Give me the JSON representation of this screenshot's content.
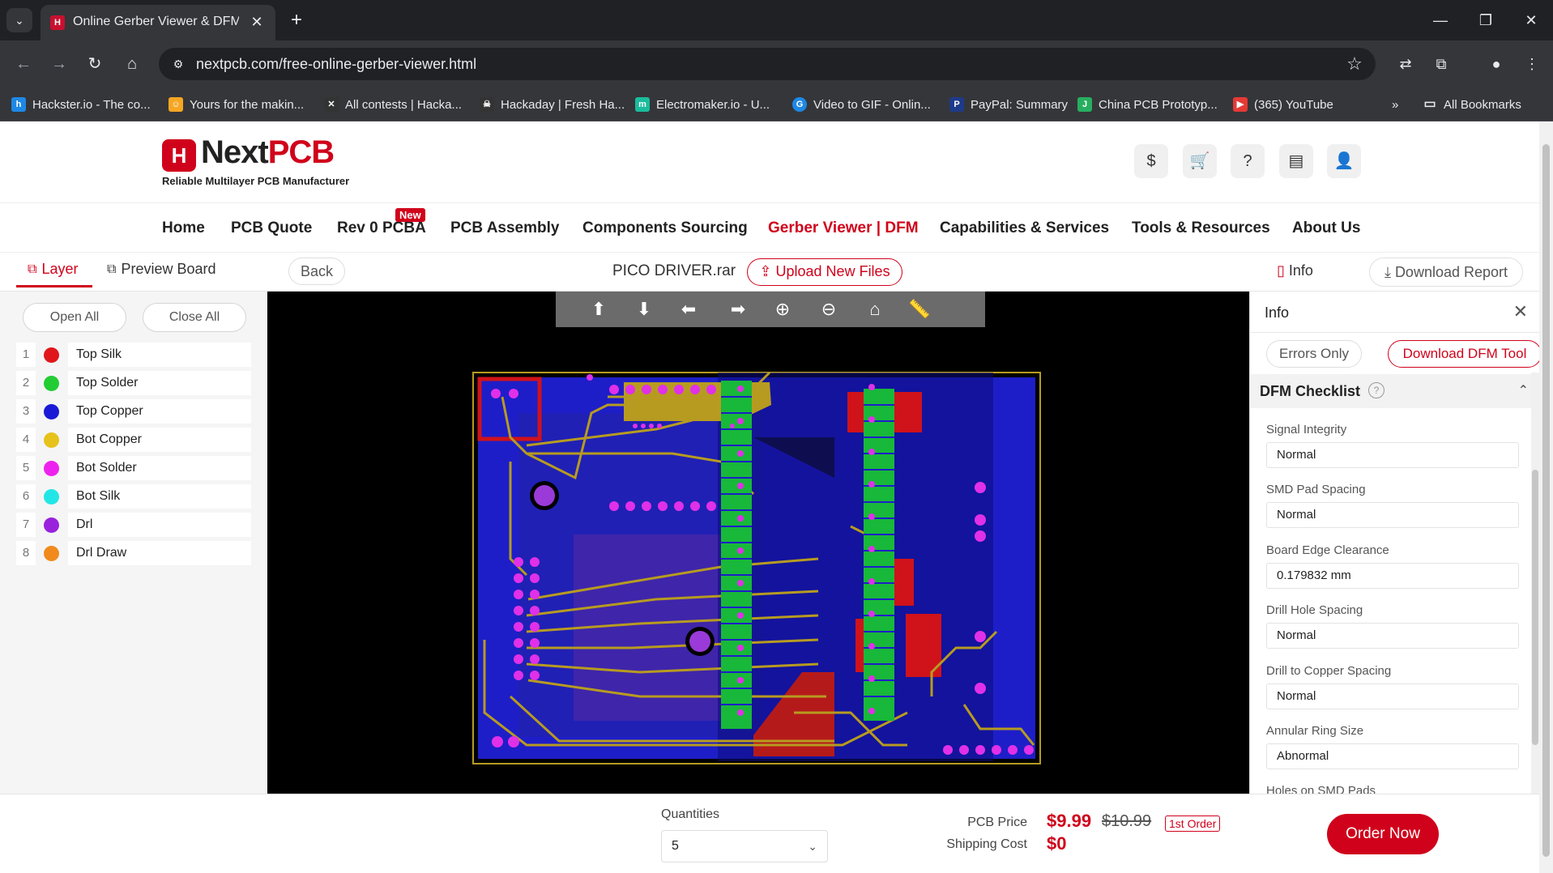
{
  "browser": {
    "tab_title": "Online Gerber Viewer & DFM A",
    "url": "nextpcb.com/free-online-gerber-viewer.html",
    "bookmarks": [
      {
        "label": "Hackster.io - The co...",
        "color": "#1e88e5"
      },
      {
        "label": "Yours for the makin...",
        "color": "#f5a623"
      },
      {
        "label": "All contests | Hacka...",
        "color": "#222222"
      },
      {
        "label": "Hackaday | Fresh Ha...",
        "color": "#222222"
      },
      {
        "label": "Electromaker.io - U...",
        "color": "#1abc9c"
      },
      {
        "label": "Video to GIF - Onlin...",
        "color": "#1e88e5"
      },
      {
        "label": "PayPal: Summary",
        "color": "#1e3a8a"
      },
      {
        "label": "China PCB Prototyp...",
        "color": "#27ae60"
      },
      {
        "label": "(365) YouTube",
        "color": "#e53935"
      }
    ],
    "all_bookmarks": "All Bookmarks"
  },
  "header": {
    "logo_next": "Next",
    "logo_pcb": "PCB",
    "tagline": "Reliable Multilayer PCB Manufacturer"
  },
  "nav": {
    "items": [
      "Home",
      "PCB Quote",
      "Rev 0 PCBA",
      "PCB Assembly",
      "Components Sourcing",
      "Gerber Viewer | DFM",
      "Capabilities & Services",
      "Tools & Resources",
      "About Us"
    ],
    "new_badge": "New"
  },
  "viewer": {
    "tab_layer": "Layer",
    "tab_preview": "Preview Board",
    "back": "Back",
    "file_name": "PICO DRIVER.rar",
    "upload": "Upload New Files",
    "info_tab": "Info",
    "download_report": "Download Report"
  },
  "layers": {
    "open_all": "Open All",
    "close_all": "Close All",
    "items": [
      {
        "num": "1",
        "name": "Top Silk",
        "color": "#e0161b"
      },
      {
        "num": "2",
        "name": "Top Solder",
        "color": "#22cc33"
      },
      {
        "num": "3",
        "name": "Top Copper",
        "color": "#1a1ad6"
      },
      {
        "num": "4",
        "name": "Bot Copper",
        "color": "#e6c21a"
      },
      {
        "num": "5",
        "name": "Bot Solder",
        "color": "#ee22ee"
      },
      {
        "num": "6",
        "name": "Bot Silk",
        "color": "#22e6e6"
      },
      {
        "num": "7",
        "name": "Drl",
        "color": "#9922dd"
      },
      {
        "num": "8",
        "name": "Drl Draw",
        "color": "#f08a1c"
      }
    ]
  },
  "info": {
    "title": "Info",
    "errors_only": "Errors Only",
    "download_dfm": "Download DFM Tool",
    "checklist_title": "DFM Checklist",
    "checks": [
      {
        "label": "Signal Integrity",
        "value": "Normal"
      },
      {
        "label": "SMD Pad Spacing",
        "value": "Normal"
      },
      {
        "label": "Board Edge Clearance",
        "value": "0.179832 mm"
      },
      {
        "label": "Drill Hole Spacing",
        "value": "Normal"
      },
      {
        "label": "Drill to Copper Spacing",
        "value": "Normal"
      },
      {
        "label": "Annular Ring Size",
        "value": "Abnormal"
      },
      {
        "label": "Holes on SMD Pads",
        "value": ""
      }
    ]
  },
  "order": {
    "quantities_label": "Quantities",
    "quantity": "5",
    "pcb_price_label": "PCB Price",
    "shipping_label": "Shipping Cost",
    "price_now": "$9.99",
    "price_old": "$10.99",
    "first_order": "1st Order",
    "shipping": "$0",
    "order_now": "Order Now"
  }
}
